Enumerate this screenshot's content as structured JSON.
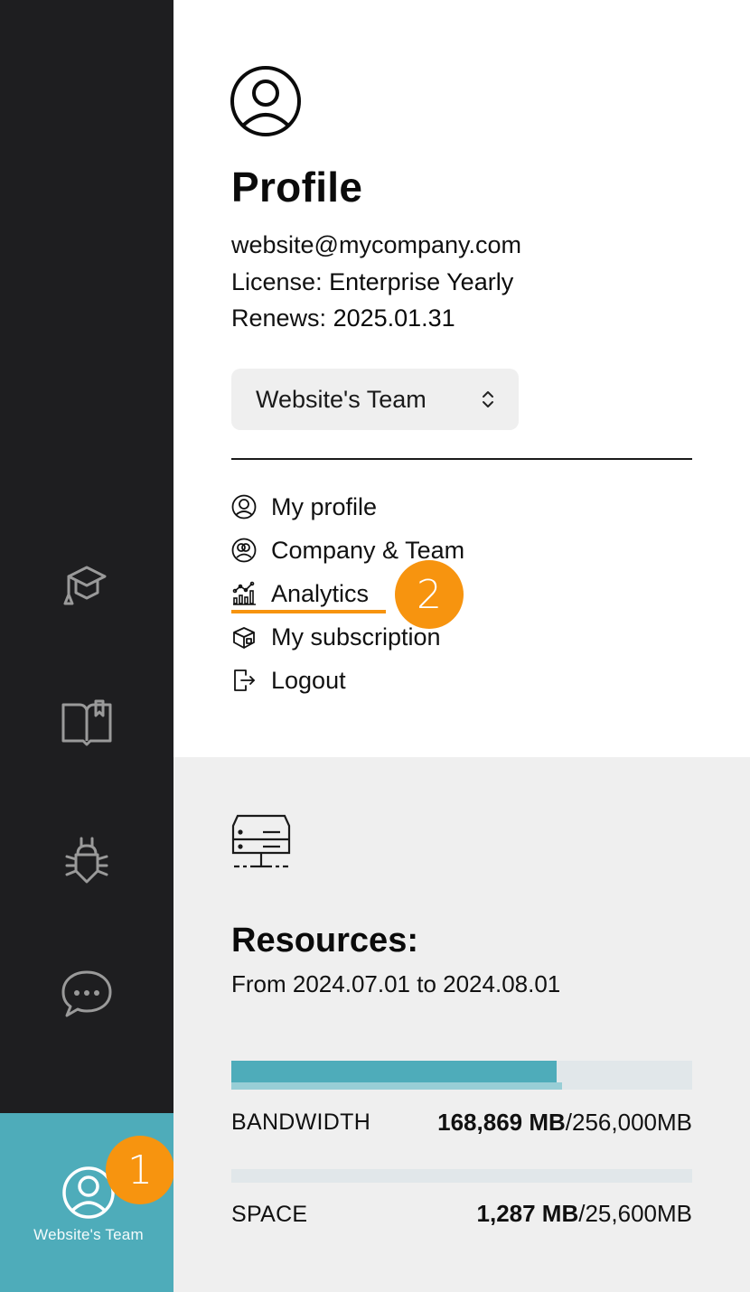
{
  "sidebar": {
    "items": [
      {
        "name": "courses",
        "icon": "graduation-cap-icon"
      },
      {
        "name": "docs",
        "icon": "book-icon"
      },
      {
        "name": "bugs",
        "icon": "bug-icon"
      },
      {
        "name": "chat",
        "icon": "chat-bubble-icon"
      }
    ],
    "active": {
      "label": "Website's Team",
      "icon": "user-circle-icon"
    }
  },
  "badges": {
    "first": "1",
    "second": "2"
  },
  "accent_color": "#4eacba",
  "highlight_color": "#f7940f",
  "profile": {
    "title": "Profile",
    "email": "website@mycompany.com",
    "license_label": "License: ",
    "license_value": "Enterprise Yearly",
    "renews_label": "Renews: ",
    "renews_value": "2025.01.31",
    "team_select": "Website's Team"
  },
  "menu": [
    {
      "label": "My profile",
      "icon": "user-circle-icon"
    },
    {
      "label": "Company & Team",
      "icon": "team-icon"
    },
    {
      "label": "Analytics",
      "icon": "analytics-chart-icon",
      "active": true
    },
    {
      "label": "My subscription",
      "icon": "box-icon"
    },
    {
      "label": "Logout",
      "icon": "logout-icon"
    }
  ],
  "resources": {
    "title": "Resources:",
    "range": "From 2024.07.01 to 2024.08.01",
    "bandwidth": {
      "label": "BANDWIDTH",
      "used": "168,869 MB",
      "total": "/256,000MB",
      "fraction": 0.705,
      "secondary_fraction": 0.718
    },
    "space": {
      "label": "SPACE",
      "used": "1,287 MB",
      "total": "/25,600MB",
      "fraction": 0.0
    }
  }
}
